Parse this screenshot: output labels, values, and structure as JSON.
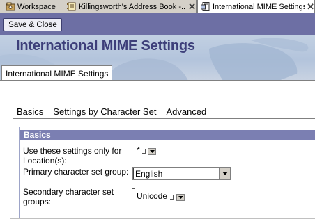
{
  "tabs": [
    {
      "label": "Workspace",
      "icon": "workspace-icon",
      "closable": false
    },
    {
      "label": "Killingsworth's Address Book -...",
      "icon": "address-book-icon",
      "closable": true
    },
    {
      "label": "International MIME Settings",
      "icon": "document-icon",
      "closable": true,
      "active": true
    }
  ],
  "close_glyph": "✕",
  "toolbar": {
    "save_close_label": "Save & Close"
  },
  "banner": {
    "title": "International MIME Settings"
  },
  "form_tab": {
    "label": "International MIME Settings"
  },
  "subtabs": [
    {
      "label": "Basics",
      "active": true
    },
    {
      "label": "Settings by Character Set",
      "active": false
    },
    {
      "label": "Advanced",
      "active": false
    }
  ],
  "section": {
    "title": "Basics",
    "fields": {
      "locations": {
        "label": "Use these settings only for Location(s):",
        "value": "*"
      },
      "primary_charset": {
        "label": "Primary character set group:",
        "value": "English"
      },
      "secondary_charset": {
        "label": "Secondary character set groups:",
        "value": "Unicode"
      }
    }
  },
  "colors": {
    "toolbar": "#6d6fa4",
    "banner_title": "#3d3f7a",
    "section_header": "#7b7fb2"
  }
}
